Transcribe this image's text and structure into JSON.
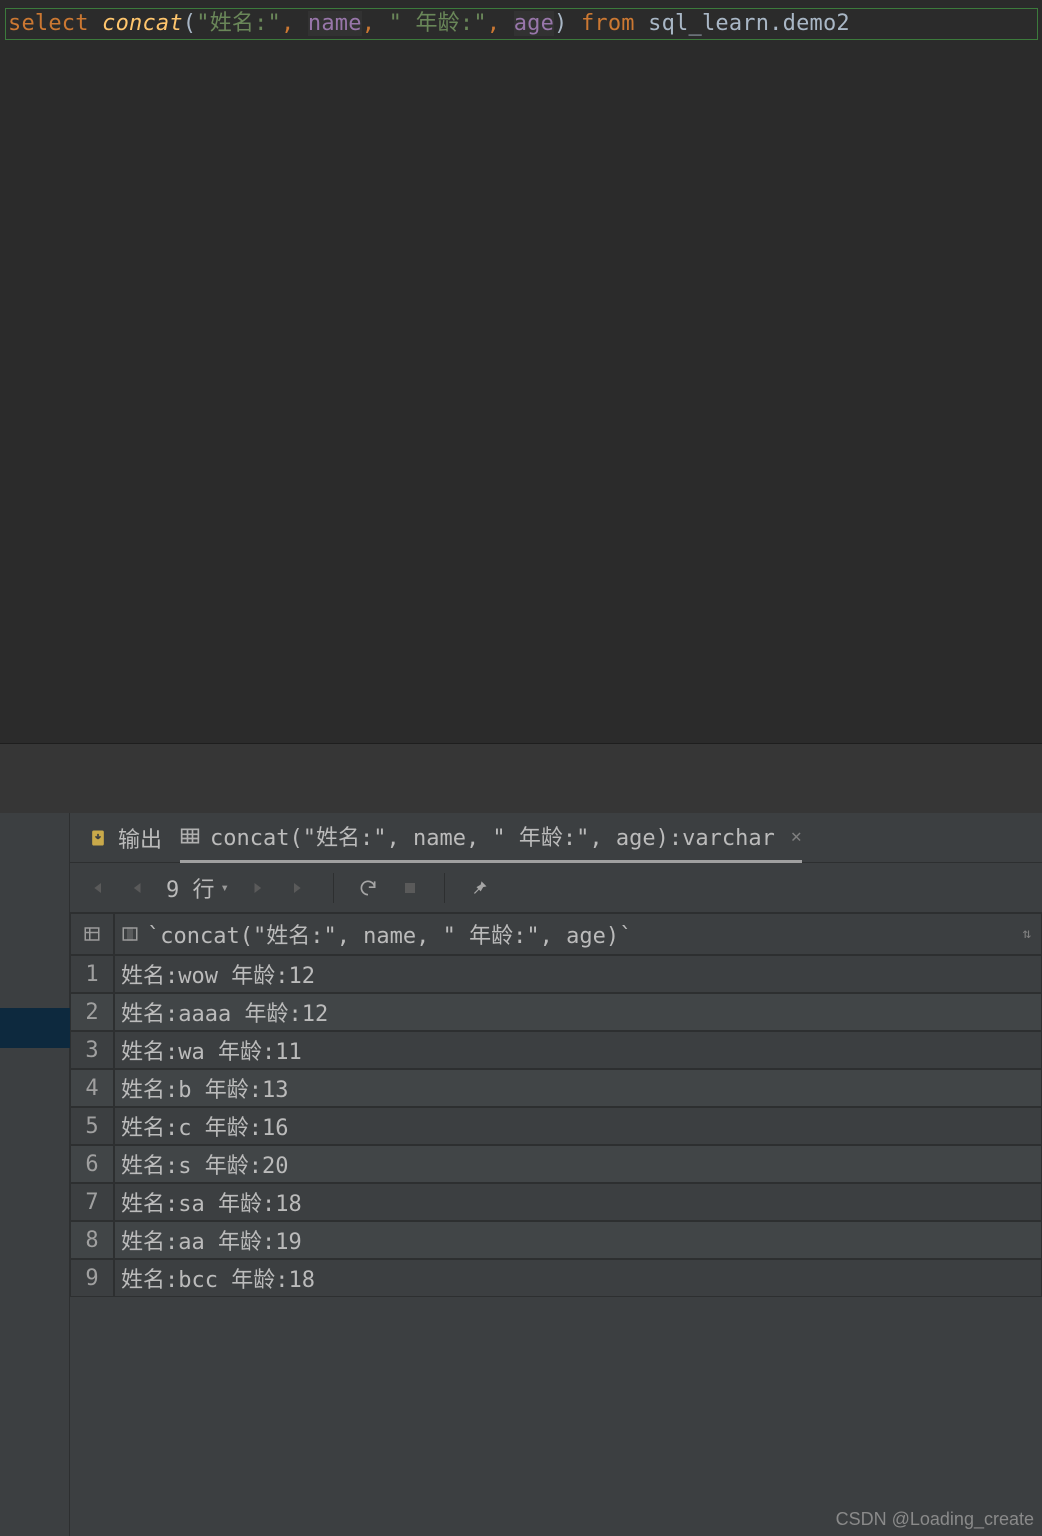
{
  "editor": {
    "sql": {
      "select": "select",
      "space": " ",
      "fn": "concat",
      "lp": "(",
      "str1": "\"姓名:\"",
      "comma": ",",
      "arg_name": "name",
      "str2": "\" 年龄:\"",
      "arg_age": "age",
      "rp": ")",
      "from": "from",
      "table": "sql_learn.demo2"
    }
  },
  "tabs": {
    "output_label": "输出",
    "result_label": "concat(\"姓名:\", name, \" 年龄:\", age):varchar"
  },
  "toolbar": {
    "rowcount_label": "9 行"
  },
  "grid": {
    "column_header": "`concat(\"姓名:\", name, \" 年龄:\", age)`",
    "rows": [
      "姓名:wow 年龄:12",
      "姓名:aaaa 年龄:12",
      "姓名:wa 年龄:11",
      "姓名:b 年龄:13",
      "姓名:c 年龄:16",
      "姓名:s 年龄:20",
      "姓名:sa 年龄:18",
      "姓名:aa 年龄:19",
      "姓名:bcc 年龄:18"
    ]
  },
  "watermark": "CSDN @Loading_create"
}
